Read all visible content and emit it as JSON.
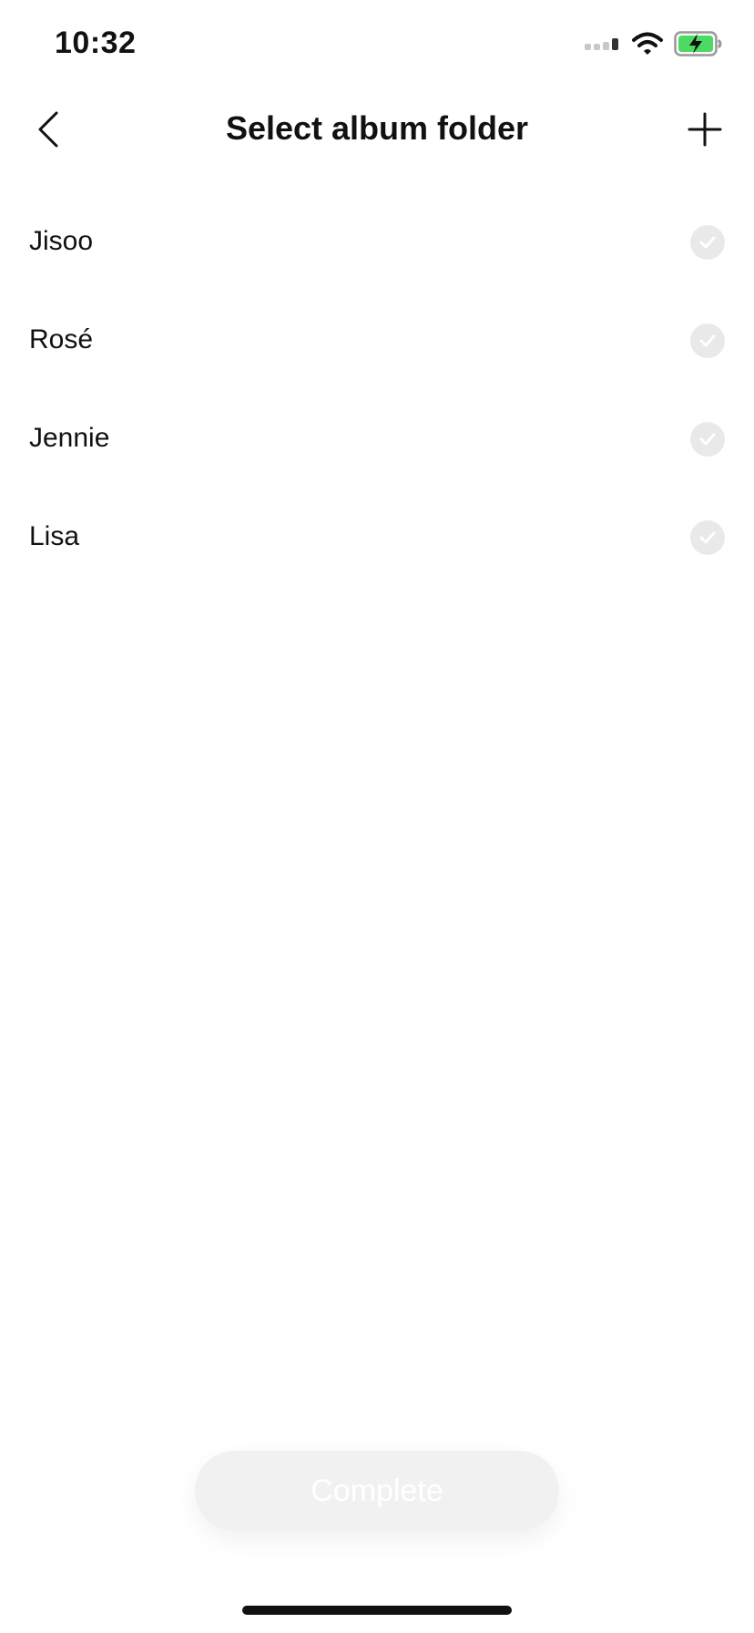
{
  "status_bar": {
    "time": "10:32",
    "icons": [
      "signal-icon",
      "wifi-icon",
      "battery-charging-icon"
    ]
  },
  "nav": {
    "title": "Select album folder",
    "back_icon": "chevron-left-icon",
    "add_icon": "plus-icon"
  },
  "folders": [
    {
      "label": "Jisoo",
      "selected": false
    },
    {
      "label": "Rosé",
      "selected": false
    },
    {
      "label": "Jennie",
      "selected": false
    },
    {
      "label": "Lisa",
      "selected": false
    }
  ],
  "footer": {
    "complete_label": "Complete",
    "enabled": false
  },
  "colors": {
    "background": "#ffffff",
    "text": "#111111",
    "check_circle": "#e9e9e9",
    "button_disabled": "#f1f1f1",
    "battery_fill": "#4cd964"
  }
}
